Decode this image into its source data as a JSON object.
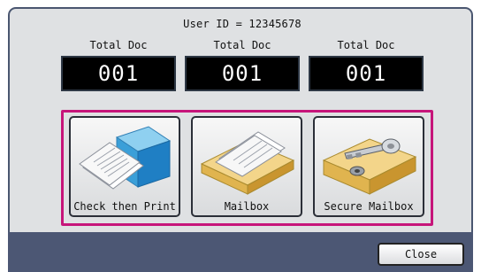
{
  "header": {
    "user_id_text": "User ID = 12345678"
  },
  "counters": [
    {
      "label": "Total Doc",
      "value": "001"
    },
    {
      "label": "Total Doc",
      "value": "001"
    },
    {
      "label": "Total Doc",
      "value": "001"
    }
  ],
  "buttons": {
    "check_then_print": {
      "label": "Check then Print",
      "icon": "document-box-icon"
    },
    "mailbox": {
      "label": "Mailbox",
      "icon": "document-tray-icon"
    },
    "secure_mailbox": {
      "label": "Secure Mailbox",
      "icon": "locked-tray-icon"
    }
  },
  "footer": {
    "close_label": "Close"
  },
  "colors": {
    "panel_bg": "#dfe1e3",
    "frame": "#4a5670",
    "highlight_border": "#c6157a",
    "counter_bg": "#000000",
    "counter_text": "#ffffff"
  }
}
